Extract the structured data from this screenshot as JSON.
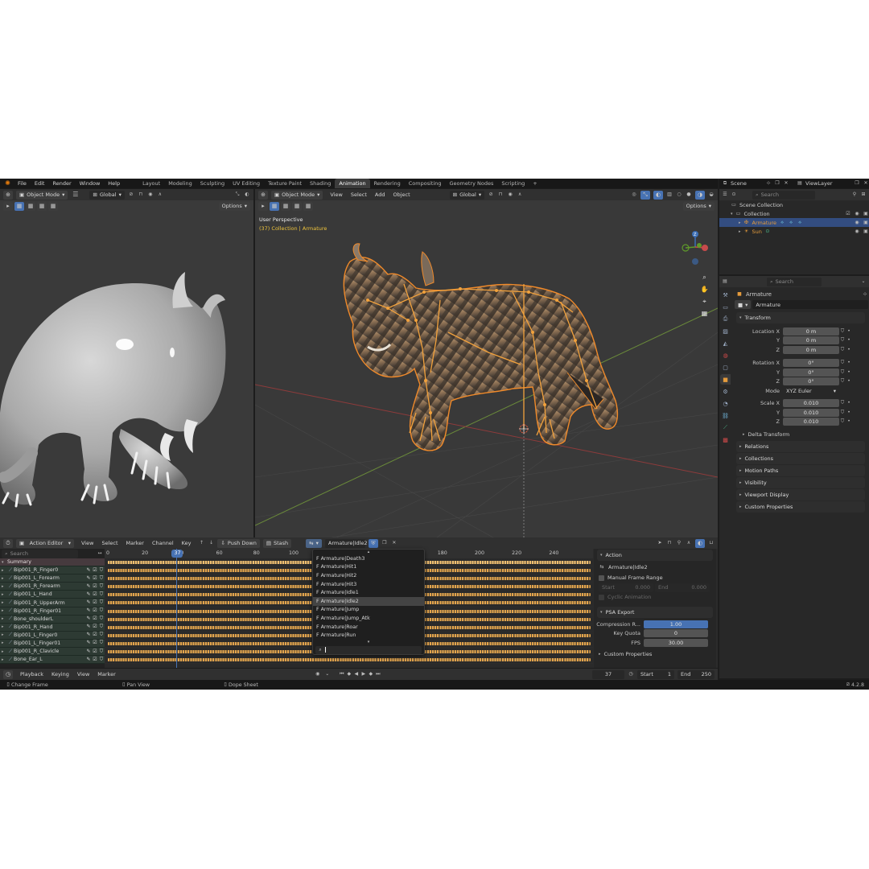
{
  "menu": [
    "File",
    "Edit",
    "Render",
    "Window",
    "Help"
  ],
  "workspaces": [
    {
      "label": "Layout",
      "active": false
    },
    {
      "label": "Modeling",
      "active": false
    },
    {
      "label": "Sculpting",
      "active": false
    },
    {
      "label": "UV Editing",
      "active": false
    },
    {
      "label": "Texture Paint",
      "active": false
    },
    {
      "label": "Shading",
      "active": false
    },
    {
      "label": "Animation",
      "active": true
    },
    {
      "label": "Rendering",
      "active": false
    },
    {
      "label": "Compositing",
      "active": false
    },
    {
      "label": "Geometry Nodes",
      "active": false
    },
    {
      "label": "Scripting",
      "active": false
    }
  ],
  "add_workspace": "+",
  "scene": {
    "label": "Scene",
    "view_layer": "ViewLayer"
  },
  "left_viewport": {
    "mode": "Object Mode",
    "orientation": "Global",
    "options": "Options"
  },
  "main_viewport": {
    "mode": "Object Mode",
    "menus": [
      "View",
      "Select",
      "Add",
      "Object"
    ],
    "orientation": "Global",
    "options": "Options",
    "perspective": "User Perspective",
    "context": "(37) Collection | Armature"
  },
  "outliner": {
    "search": "Search",
    "scene_collection": "Scene Collection",
    "collection": "Collection",
    "items": [
      {
        "label": "Armature",
        "selected": true
      },
      {
        "label": "Sun",
        "selected": false
      }
    ]
  },
  "properties": {
    "search": "Search",
    "object_name": "Armature",
    "data_name": "Armature",
    "transform_label": "Transform",
    "location": {
      "label": "Location X",
      "x": "0 m",
      "y": "0 m",
      "z": "0 m"
    },
    "rotation": {
      "label": "Rotation X",
      "x": "0°",
      "y": "0°",
      "z": "0°"
    },
    "mode_label": "Mode",
    "mode_value": "XYZ Euler",
    "scale": {
      "label": "Scale X",
      "x": "0.010",
      "y": "0.010",
      "z": "0.010"
    },
    "axis_y": "Y",
    "axis_z": "Z",
    "delta": "Delta Transform",
    "sections": [
      "Relations",
      "Collections",
      "Motion Paths",
      "Visibility",
      "Viewport Display",
      "Custom Properties"
    ]
  },
  "dopesheet": {
    "editor": "Action Editor",
    "menus": [
      "View",
      "Select",
      "Marker",
      "Channel",
      "Key"
    ],
    "push_down": "Push Down",
    "stash": "Stash",
    "action": "Armature|Idle2",
    "search": "Search",
    "current_frame": "37",
    "ticks": [
      {
        "label": "0",
        "frame": 0
      },
      {
        "label": "20",
        "frame": 20
      },
      {
        "label": "0",
        "frame": 40
      },
      {
        "label": "60",
        "frame": 60
      },
      {
        "label": "80",
        "frame": 80
      },
      {
        "label": "100",
        "frame": 100
      },
      {
        "label": "180",
        "frame": 180
      },
      {
        "label": "200",
        "frame": 200
      },
      {
        "label": "220",
        "frame": 220
      },
      {
        "label": "240",
        "frame": 240
      }
    ],
    "channels": [
      {
        "label": "Summary",
        "summary": true
      },
      {
        "label": "Bip001_R_Finger0"
      },
      {
        "label": "Bip001_L_Forearm"
      },
      {
        "label": "Bip001_R_Forearm"
      },
      {
        "label": "Bip001_L_Hand"
      },
      {
        "label": "Bip001_R_UpperArm"
      },
      {
        "label": "Bip001_R_Finger01"
      },
      {
        "label": "Bone_shoulderL"
      },
      {
        "label": "Bip001_R_Hand"
      },
      {
        "label": "Bip001_L_Finger0"
      },
      {
        "label": "Bip001_L_Finger01"
      },
      {
        "label": "Bip001_R_Clavicle"
      },
      {
        "label": "Bone_Ear_L"
      }
    ],
    "action_list": [
      {
        "label": "F Armature|Death3",
        "selected": false
      },
      {
        "label": "F Armature|Hit1",
        "selected": false
      },
      {
        "label": "F Armature|Hit2",
        "selected": false
      },
      {
        "label": "F Armature|Hit3",
        "selected": false
      },
      {
        "label": "F Armature|Idle1",
        "selected": false
      },
      {
        "label": "F Armature|Idle2",
        "selected": true
      },
      {
        "label": "F Armature|Jump",
        "selected": false
      },
      {
        "label": "F Armature|Jump_Atk",
        "selected": false
      },
      {
        "label": "F Armature|Roar",
        "selected": false
      },
      {
        "label": "F Armature|Run",
        "selected": false
      }
    ]
  },
  "action_panel": {
    "title": "Action",
    "action_name": "Armature|Idle2",
    "manual_range": "Manual Frame Range",
    "start_label": "Start",
    "start_value": "0.000",
    "end_label": "End",
    "end_value": "0.000",
    "cyclic": "Cyclic Animation",
    "psa_title": "PSA Export",
    "compression_label": "Compression R...",
    "compression_value": "1.00",
    "compression_fraction": 1.0,
    "key_quota_label": "Key Quota",
    "key_quota_value": "0",
    "fps_label": "FPS",
    "fps_value": "30.00",
    "custom": "Custom Properties"
  },
  "timeline": {
    "menus": [
      "Playback",
      "Keying",
      "View",
      "Marker"
    ],
    "frame": "37",
    "start_label": "Start",
    "start_value": "1",
    "end_label": "End",
    "end_value": "250"
  },
  "status": {
    "hint1": "Change Frame",
    "hint2": "Pan View",
    "hint3": "Dope Sheet",
    "version": "4.2.8"
  },
  "colors": {
    "accent_orange": "#e59b3c",
    "selection_blue": "#334d80",
    "keyframe": "#e3a54d",
    "playhead": "#4772b3"
  }
}
